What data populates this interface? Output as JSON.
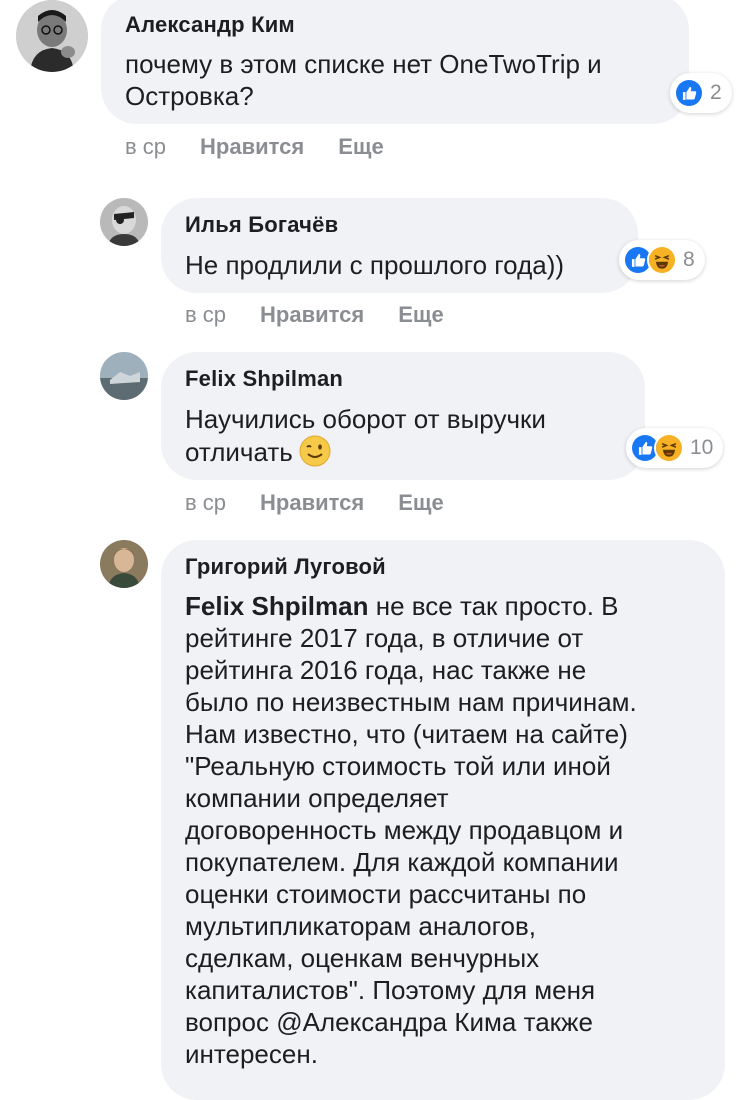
{
  "comments": [
    {
      "author": "Александр Ким",
      "text_lines": [
        "почему в этом списке нет OneTwoTrip и",
        "Островка?"
      ],
      "reactions": [
        "like-icon"
      ],
      "reaction_count": "2",
      "time": "в ср",
      "like_label": "Нравится",
      "more_label": "Еще"
    },
    {
      "author": "Илья Богачёв",
      "text_lines": [
        "Не продлили с прошлого года))"
      ],
      "reactions": [
        "like-icon",
        "haha-icon"
      ],
      "reaction_count": "8",
      "time": "в ср",
      "like_label": "Нравится",
      "more_label": "Еще"
    },
    {
      "author": "Felix Shpilman",
      "text_lines": [
        "Научились оборот от выручки",
        "отличать"
      ],
      "inline_emoji": "wink-emoji",
      "reactions": [
        "like-icon",
        "haha-icon"
      ],
      "reaction_count": "10",
      "time": "в ср",
      "like_label": "Нравится",
      "more_label": "Еще"
    },
    {
      "author": "Григорий Луговой",
      "mention": "Felix Shpilman",
      "text_lines": [
        " не все так просто. В",
        "рейтинге 2017 года, в отличие от",
        "рейтинга 2016 года, нас также не",
        "было по неизвестным нам причинам.",
        "Нам известно, что (читаем на сайте)",
        "\"Реальную стоимость той или иной",
        "компании определяет",
        "договоренность между продавцом и",
        "покупателем. Для каждой компании",
        "оценки стоимости рассчитаны по",
        "мультипликаторам аналогов,",
        "сделкам, оценкам венчурных",
        "капиталистов\". Поэтому для меня",
        "вопрос @Александра Кима также",
        "интересен."
      ]
    }
  ],
  "colors": {
    "bubble": "#f0f2f5",
    "meta": "#8a8d91",
    "like": "#1877f2",
    "haha": "#f7b125"
  }
}
